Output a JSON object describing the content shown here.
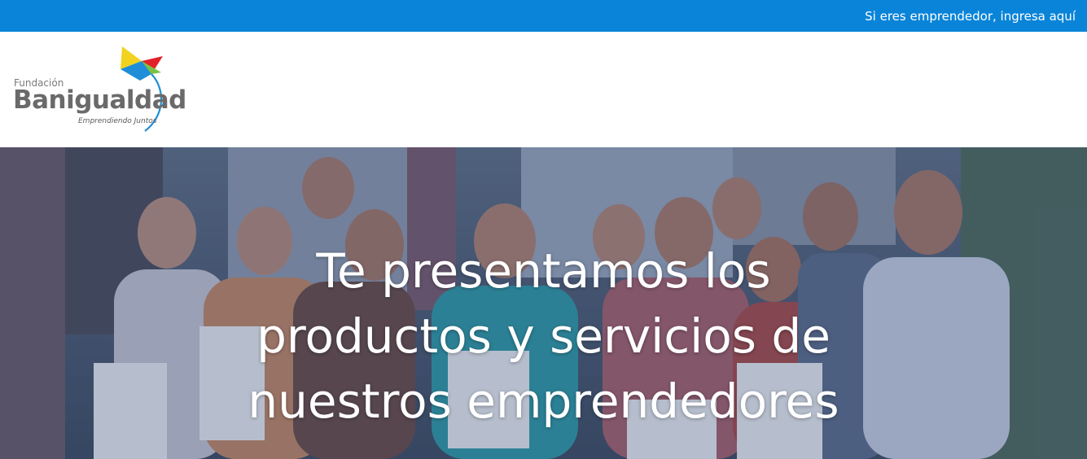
{
  "topbar": {
    "link_label": "Si eres emprendedor, ingresa aquí",
    "background": "#0a84d8"
  },
  "logo": {
    "prefix": "Fundación",
    "name": "Banigualdad",
    "tagline": "Emprendiendo Juntos",
    "kite_colors": [
      "#f2d21e",
      "#e3212b",
      "#1e8ed8",
      "#7cc142"
    ]
  },
  "hero": {
    "headline_lines": [
      "Te presentamos los",
      "productos y servicios de",
      "nuestros emprendedores"
    ],
    "overlay_color": "#283c64"
  }
}
